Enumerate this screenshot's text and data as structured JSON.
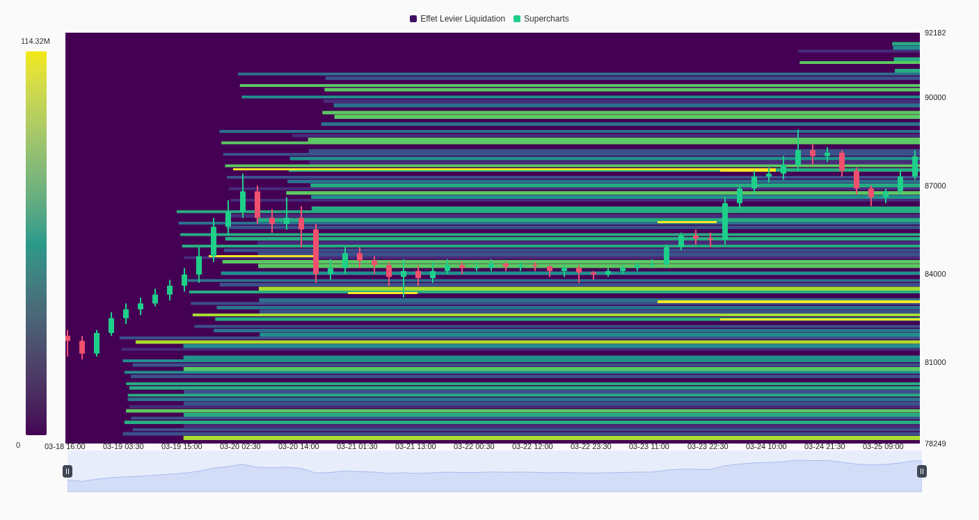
{
  "legend": [
    {
      "label": "Effet Levier Liquidation",
      "color": "#3d1162"
    }
  ],
  "color_scale": {
    "max_label": "114.32M",
    "min_label": "0"
  },
  "chart_data": {
    "type": "candlestick",
    "categories": [
      "03-18 16:00",
      null,
      null,
      null,
      "03-19 03:30",
      null,
      null,
      null,
      "03-19 15:00",
      null,
      null,
      null,
      "03-20 02:30",
      null,
      null,
      null,
      "03-20 14:00",
      null,
      null,
      null,
      "03-21 01:30",
      null,
      null,
      null,
      "03-21 13:00",
      null,
      null,
      null,
      "03-22 00:30",
      null,
      null,
      null,
      "03-22 12:00",
      null,
      null,
      null,
      "03-22 23:30",
      null,
      null,
      null,
      "03-23 11:00",
      null,
      null,
      null,
      "03-23 22:30",
      null,
      null,
      null,
      "03-24 10:00",
      null,
      null,
      null,
      "03-24 21:30",
      null,
      null,
      null,
      "03-25 09:00",
      null,
      null
    ],
    "series": [
      {
        "name": "Supercharts",
        "ohlc": [
          [
            81900,
            82100,
            81200,
            81730
          ],
          [
            81730,
            81900,
            81100,
            81300
          ],
          [
            81300,
            82100,
            81200,
            82000
          ],
          [
            82000,
            82700,
            81900,
            82500
          ],
          [
            82500,
            83000,
            82300,
            82800
          ],
          [
            82800,
            83200,
            82600,
            83000
          ],
          [
            83000,
            83500,
            82900,
            83300
          ],
          [
            83300,
            83800,
            83100,
            83600
          ],
          [
            83600,
            84200,
            83400,
            83980
          ],
          [
            83980,
            84900,
            83700,
            84600
          ],
          [
            84600,
            85900,
            84400,
            85600
          ],
          [
            85600,
            86500,
            85300,
            86100
          ],
          [
            86100,
            87400,
            85900,
            86800
          ],
          [
            86800,
            87000,
            85700,
            85900
          ],
          [
            85900,
            86200,
            85400,
            85700
          ],
          [
            85700,
            86600,
            85500,
            85900
          ],
          [
            85900,
            86300,
            84900,
            85510
          ],
          [
            85510,
            85700,
            83700,
            84000
          ],
          [
            84000,
            84500,
            83800,
            84200
          ],
          [
            84200,
            84900,
            84000,
            84700
          ],
          [
            84700,
            84900,
            84200,
            84450
          ],
          [
            84450,
            84600,
            84000,
            84300
          ],
          [
            84300,
            84400,
            83600,
            83900
          ],
          [
            83900,
            84500,
            83200,
            84100
          ],
          [
            84100,
            84300,
            83600,
            83860
          ],
          [
            83860,
            84400,
            83700,
            84100
          ],
          [
            84100,
            84500,
            84000,
            84300
          ],
          [
            84300,
            84400,
            84000,
            84200
          ],
          [
            84200,
            84400,
            84100,
            84210
          ],
          [
            84210,
            84500,
            84100,
            84350
          ],
          [
            84350,
            84400,
            84100,
            84250
          ],
          [
            84250,
            84400,
            84100,
            84300
          ],
          [
            84300,
            84400,
            84100,
            84260
          ],
          [
            84260,
            84300,
            83900,
            84100
          ],
          [
            84100,
            84300,
            83900,
            84200
          ],
          [
            84200,
            84300,
            83700,
            84050
          ],
          [
            84050,
            84100,
            83800,
            83980
          ],
          [
            83980,
            84200,
            83900,
            84100
          ],
          [
            84100,
            84300,
            84000,
            84200
          ],
          [
            84200,
            84400,
            84100,
            84300
          ],
          [
            84300,
            84500,
            84200,
            84330
          ],
          [
            84330,
            85000,
            84200,
            84900
          ],
          [
            84900,
            85400,
            84800,
            85300
          ],
          [
            85300,
            85500,
            85000,
            85200
          ],
          [
            85200,
            85400,
            84900,
            85160
          ],
          [
            85160,
            86600,
            85000,
            86400
          ],
          [
            86400,
            87000,
            86200,
            86900
          ],
          [
            86900,
            87500,
            86700,
            87300
          ],
          [
            87300,
            87600,
            87100,
            87400
          ],
          [
            87400,
            88000,
            87200,
            87700
          ],
          [
            87700,
            88900,
            87500,
            88200
          ],
          [
            88200,
            88400,
            87700,
            88000
          ],
          [
            88000,
            88300,
            87800,
            88110
          ],
          [
            88110,
            88200,
            87300,
            87500
          ],
          [
            87500,
            87600,
            86700,
            86900
          ],
          [
            86900,
            87000,
            86300,
            86600
          ],
          [
            86600,
            86900,
            86400,
            86810
          ],
          [
            86810,
            87500,
            86700,
            87300
          ],
          [
            87300,
            88200,
            87200,
            87990
          ]
        ]
      }
    ],
    "ylim": [
      78249,
      92182
    ],
    "yticks": [
      92182,
      90000,
      87000,
      84000,
      81000,
      78249
    ]
  }
}
